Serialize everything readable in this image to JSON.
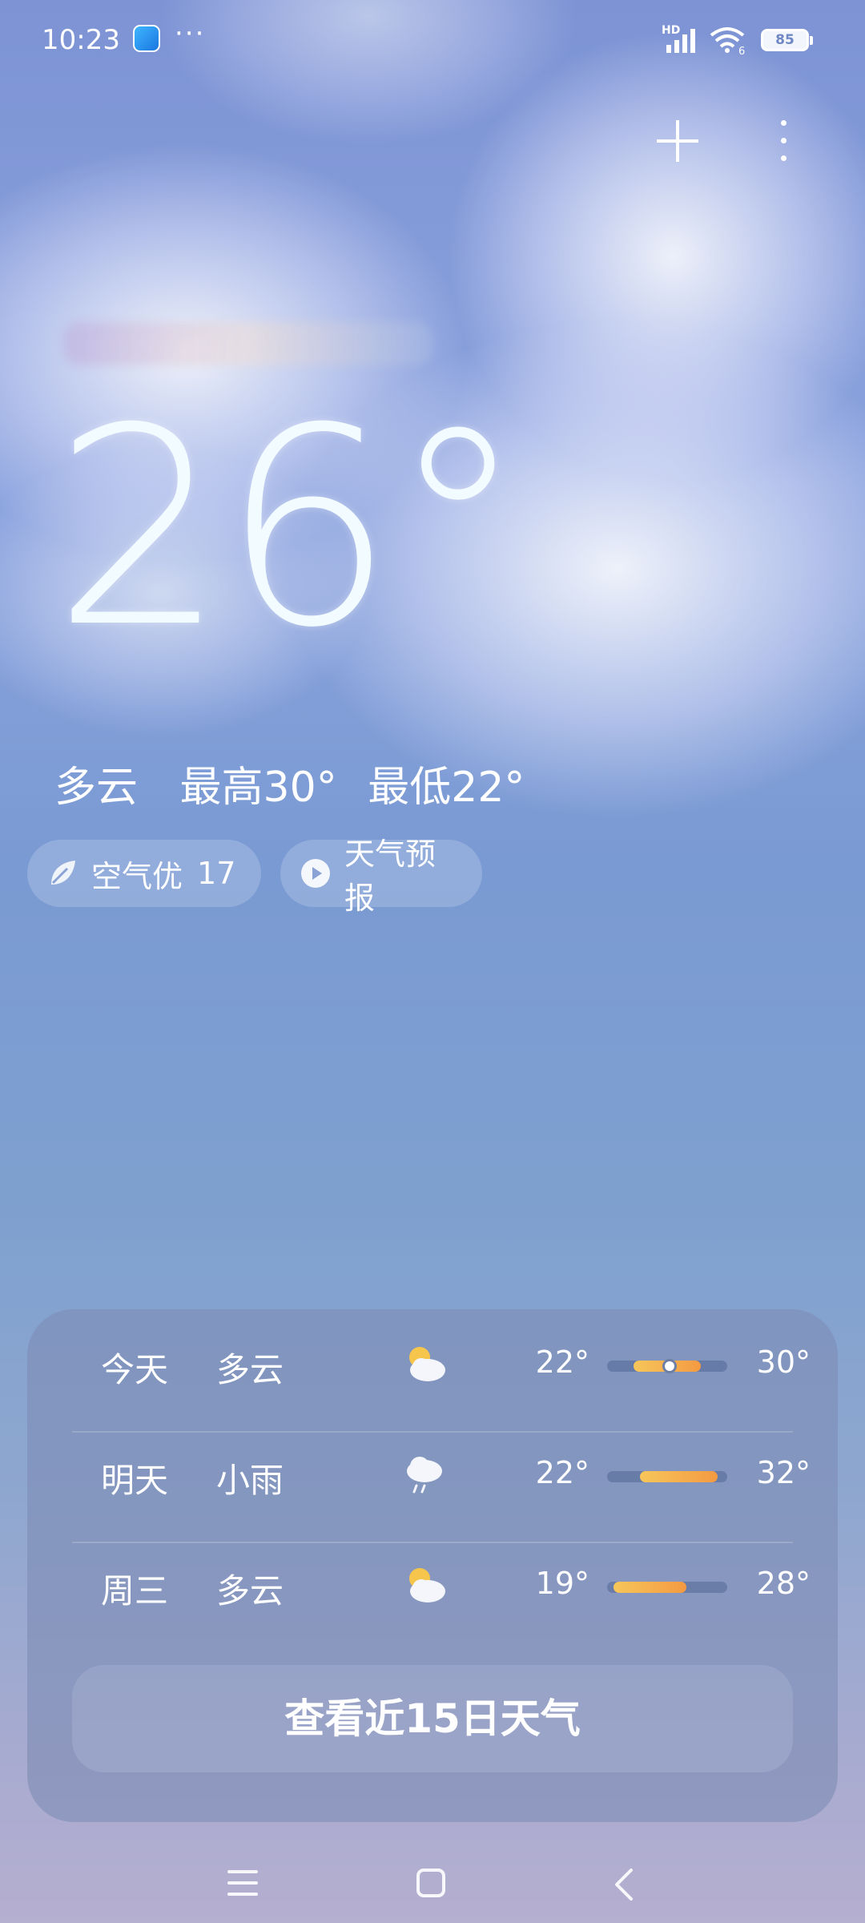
{
  "status_bar": {
    "time": "10:23",
    "dots": "···",
    "network": "HD",
    "wifi_badge": "6",
    "battery": "85",
    "app_icon": "weather-app-icon"
  },
  "header": {
    "add_icon": "plus-icon",
    "more_icon": "more-vertical-icon"
  },
  "current": {
    "temperature": "26°",
    "condition": "多云",
    "high": "最高30°",
    "low": "最低22°"
  },
  "chips": {
    "air": {
      "label": "空气优",
      "value": "17",
      "icon": "leaf-icon"
    },
    "forecast_video": {
      "label": "天气预报",
      "icon": "play-icon"
    }
  },
  "forecast": [
    {
      "day": "今天",
      "condition": "多云",
      "icon": "partly-cloudy-icon",
      "low": "22°",
      "high": "30°",
      "bar_start": 0.22,
      "bar_end": 0.78,
      "current": 0.52
    },
    {
      "day": "明天",
      "condition": "小雨",
      "icon": "light-rain-icon",
      "low": "22°",
      "high": "32°",
      "bar_start": 0.27,
      "bar_end": 0.92,
      "current": null
    },
    {
      "day": "周三",
      "condition": "多云",
      "icon": "partly-cloudy-icon",
      "low": "19°",
      "high": "28°",
      "bar_start": 0.05,
      "bar_end": 0.66,
      "current": null
    }
  ],
  "more_button": "查看近15日天气",
  "colors": {
    "accent_warm": "#f7c65a",
    "accent_hot": "#f49a42"
  },
  "nav": {
    "menu_icon": "menu-icon",
    "home_icon": "home-icon",
    "back_icon": "back-icon"
  }
}
